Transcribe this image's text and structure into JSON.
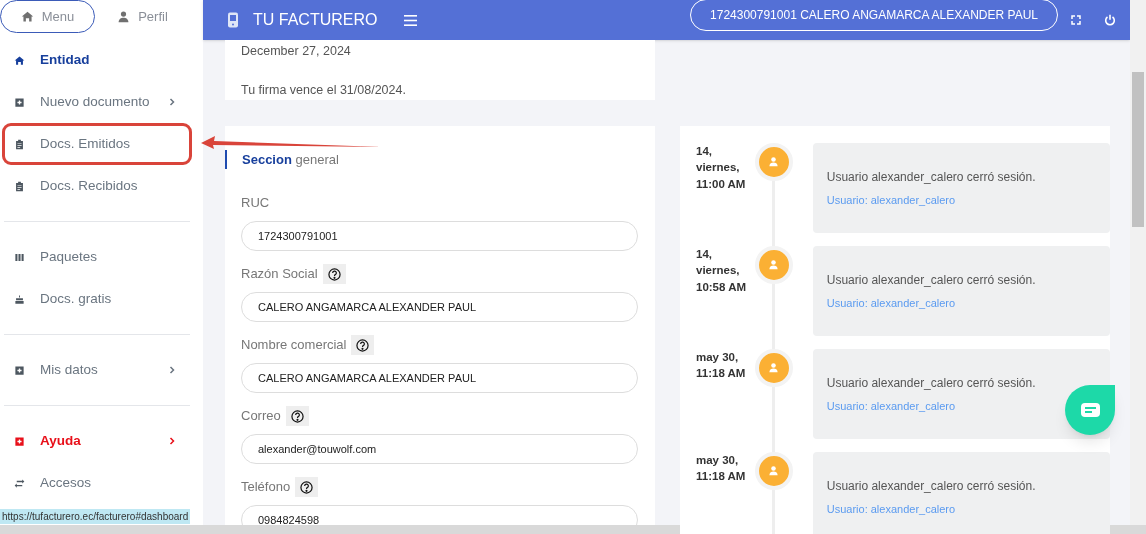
{
  "sidebar": {
    "tabs": [
      {
        "label": "Menu",
        "selected": true
      },
      {
        "label": "Perfil",
        "selected": false
      }
    ],
    "items": [
      {
        "kind": "home",
        "label": "Entidad",
        "selected": true,
        "submenu": false,
        "alert": false,
        "highlighted": false
      },
      {
        "kind": "plus",
        "label": "Nuevo documento",
        "selected": false,
        "submenu": true,
        "alert": false,
        "highlighted": false
      },
      {
        "kind": "clipboard",
        "label": "Docs. Emitidos",
        "selected": false,
        "submenu": false,
        "alert": false,
        "highlighted": true
      },
      {
        "kind": "clipboard",
        "label": "Docs. Recibidos",
        "selected": false,
        "submenu": false,
        "alert": false,
        "highlighted": false
      },
      {
        "kind": "divider"
      },
      {
        "kind": "columns",
        "label": "Paquetes",
        "selected": false,
        "submenu": false,
        "alert": false,
        "highlighted": false
      },
      {
        "kind": "cake",
        "label": "Docs. gratis",
        "selected": false,
        "submenu": false,
        "alert": false,
        "highlighted": false
      },
      {
        "kind": "divider"
      },
      {
        "kind": "plus",
        "label": "Mis datos",
        "selected": false,
        "submenu": true,
        "alert": false,
        "highlighted": false
      },
      {
        "kind": "divider"
      },
      {
        "kind": "plus",
        "label": "Ayuda",
        "selected": false,
        "submenu": true,
        "alert": true,
        "highlighted": false
      },
      {
        "kind": "swap",
        "label": "Accesos",
        "selected": false,
        "submenu": false,
        "alert": false,
        "highlighted": false
      }
    ]
  },
  "header": {
    "brand": "TU FACTURERO",
    "user": "1724300791001 CALERO ANGAMARCA ALEXANDER PAUL"
  },
  "notice": {
    "date": "December 27, 2024",
    "message": "Tu firma vence el 31/08/2024."
  },
  "form": {
    "title": "**Seccion** general",
    "fields": [
      {
        "label": "RUC",
        "value": "1724300791001",
        "help": false
      },
      {
        "label": "Razón Social",
        "value": "CALERO ANGAMARCA ALEXANDER PAUL",
        "help": true
      },
      {
        "label": "Nombre comercial",
        "value": "CALERO ANGAMARCA ALEXANDER PAUL",
        "help": true
      },
      {
        "label": "Correo",
        "value": "alexander@touwolf.com",
        "help": true
      },
      {
        "label": "Teléfono",
        "value": "0984824598",
        "help": true
      }
    ]
  },
  "timeline": [
    {
      "time": "14, viernes, 11:00 AM",
      "message": "Usuario alexander_calero cerró sesión.",
      "link": "Usuario: alexander_calero"
    },
    {
      "time": "14, viernes, 10:58 AM",
      "message": "Usuario alexander_calero cerró sesión.",
      "link": "Usuario: alexander_calero"
    },
    {
      "time": "may 30, 11:18 AM",
      "message": "Usuario alexander_calero cerró sesión.",
      "link": "Usuario: alexander_calero"
    },
    {
      "time": "may 30, 11:18 AM",
      "message": "Usuario alexander_calero cerró sesión.",
      "link": "Usuario: alexander_calero"
    }
  ],
  "status_url": "https://tufacturero.ec/facturero#dashboard"
}
